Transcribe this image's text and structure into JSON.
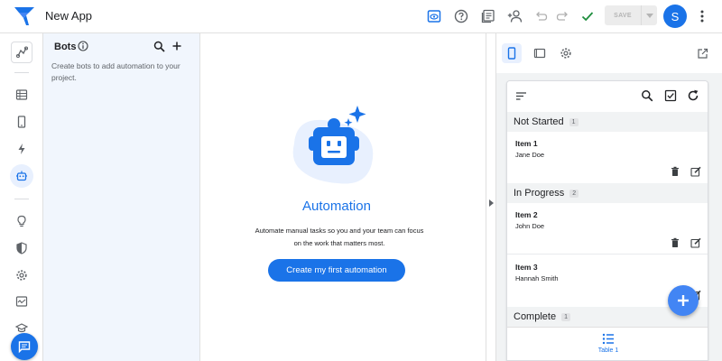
{
  "app": {
    "name": "New App",
    "save_label": "SAVE",
    "avatar_initial": "S",
    "accent": "#1a73e8"
  },
  "topbar_icons": [
    "preview-toggle-icon",
    "help-icon",
    "docs-icon",
    "share-icon",
    "undo-icon",
    "redo-icon",
    "check-icon"
  ],
  "rail": {
    "items": [
      "start-icon",
      "data-icon",
      "app-views-icon",
      "actions-icon",
      "automation-icon",
      "intelligence-icon",
      "security-icon",
      "settings-icon",
      "manage-icon",
      "learn-icon"
    ],
    "active": "automation-icon"
  },
  "bots_panel": {
    "title": "Bots",
    "description": "Create bots to add automation to your project."
  },
  "main": {
    "title": "Automation",
    "description_line1": "Automate manual tasks so you and your team can focus",
    "description_line2": "on the work that matters most.",
    "cta_label": "Create my first automation"
  },
  "preview": {
    "groups": [
      {
        "name": "Not Started",
        "count": "1"
      },
      {
        "name": "In Progress",
        "count": "2"
      },
      {
        "name": "Complete",
        "count": "1"
      }
    ],
    "items": [
      {
        "title": "Item 1",
        "assignee": "Jane Doe"
      },
      {
        "title": "Item 2",
        "assignee": "John Doe"
      },
      {
        "title": "Item 3",
        "assignee": "Hannah Smith"
      }
    ],
    "nav_tab_label": "Table 1"
  }
}
